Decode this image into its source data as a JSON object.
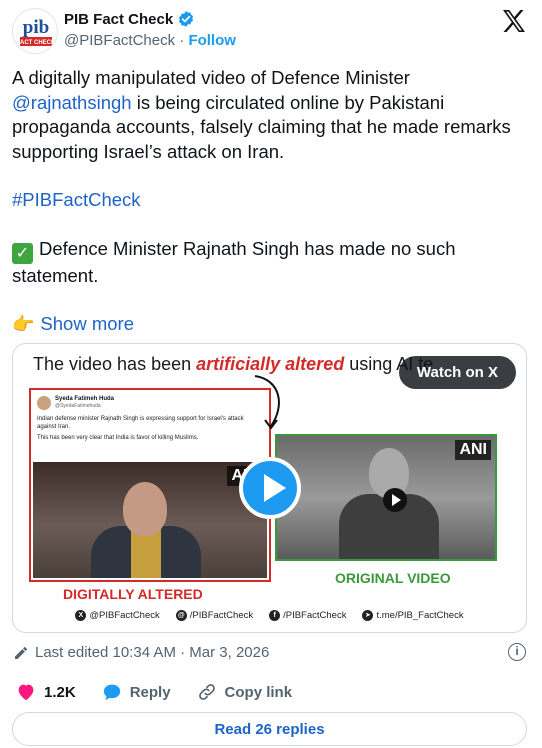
{
  "header": {
    "display_name": "PIB Fact Check",
    "handle": "@PIBFactCheck",
    "separator": "·",
    "follow_label": "Follow",
    "verified": true,
    "avatar_text_top": "pib",
    "avatar_text_bottom": "FACT CHECK"
  },
  "tweet": {
    "line1_prefix": "A digitally manipulated video of Defence Minister",
    "mention": "@rajnathsingh",
    "line1_suffix": " is being circulated online by Pakistani propaganda accounts, falsely claiming that he made remarks supporting Israel’s attack on Iran.",
    "hashtag": "#PIBFactCheck",
    "check_emoji": "✓",
    "statement": "Defence Minister Rajnath Singh has made no such statement.",
    "hand_emoji": "👉",
    "show_more_label": "Show more"
  },
  "media": {
    "headline_prefix": "The video has been ",
    "headline_emphasis": "artificially altered",
    "headline_suffix": " using AI te",
    "watch_label": "Watch on X",
    "fake_post": {
      "name": "Syeda Fatimeh Huda",
      "handle": "@SyedaFatimehuda",
      "line1": "Indian defense minister Rajnath Singh is expressing support for Israel's attack against Iran.",
      "line2": "This has been very clear that India is favor of killing Muslims."
    },
    "ani_label": "ANI",
    "label_altered": "DIGITALLY ALTERED",
    "label_original": "ORIGINAL VIDEO",
    "handles": [
      {
        "icon": "x-icon",
        "glyph": "X",
        "text": "@PIBFactCheck"
      },
      {
        "icon": "instagram-threads-icon",
        "glyph": "@",
        "text": "/PIBFactCheck"
      },
      {
        "icon": "facebook-icon",
        "glyph": "f",
        "text": "/PIBFactCheck"
      },
      {
        "icon": "telegram-icon",
        "glyph": "➤",
        "text": "t.me/PIB_FactCheck"
      }
    ]
  },
  "meta": {
    "edited_text": "Last edited 10:34 AM · Mar 3, 2026"
  },
  "actions": {
    "likes": "1.2K",
    "reply_label": "Reply",
    "copy_link_label": "Copy link"
  },
  "replies_button": "Read 26 replies",
  "colors": {
    "accent_blue": "#1d9bf0",
    "link_blue": "#1d63c8",
    "alert_red": "#d42a2a",
    "ok_green": "#3a9a3a",
    "like_pink": "#f91880"
  }
}
